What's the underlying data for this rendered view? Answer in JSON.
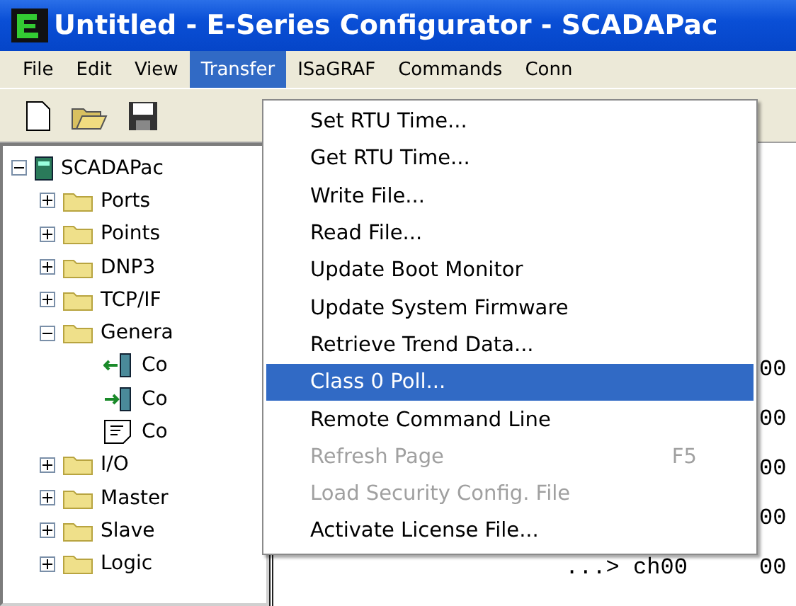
{
  "window": {
    "title": "Untitled - E-Series Configurator - SCADAPac"
  },
  "menu_bar": [
    {
      "label": "File",
      "selected": false
    },
    {
      "label": "Edit",
      "selected": false
    },
    {
      "label": "View",
      "selected": false
    },
    {
      "label": "Transfer",
      "selected": true
    },
    {
      "label": "ISaGRAF",
      "selected": false
    },
    {
      "label": "Commands",
      "selected": false
    },
    {
      "label": "Conn",
      "selected": false
    }
  ],
  "toolbar": [
    {
      "kind": "new"
    },
    {
      "kind": "open"
    },
    {
      "kind": "save"
    }
  ],
  "tree": [
    {
      "label": "SCADAPac",
      "kind": "device",
      "expanded": true,
      "children": [
        {
          "label": "Ports",
          "kind": "folder",
          "expanded": false
        },
        {
          "label": "Points",
          "kind": "folder",
          "expanded": false
        },
        {
          "label": "DNP3",
          "kind": "folder",
          "expanded": false
        },
        {
          "label": "TCP/IF",
          "kind": "folder",
          "expanded": false
        },
        {
          "label": "Genera",
          "kind": "folder",
          "expanded": true,
          "children": [
            {
              "label": "Co",
              "kind": "input"
            },
            {
              "label": "Co",
              "kind": "output"
            },
            {
              "label": "Co",
              "kind": "note"
            }
          ]
        },
        {
          "label": "I/O",
          "kind": "folder",
          "expanded": false
        },
        {
          "label": "Master",
          "kind": "folder",
          "expanded": false
        },
        {
          "label": "Slave",
          "kind": "folder",
          "expanded": false
        },
        {
          "label": "Logic",
          "kind": "folder",
          "expanded": false
        }
      ]
    }
  ],
  "log_lines": [
    {
      "value": "00"
    },
    {
      "value": "00"
    },
    {
      "value": "00"
    },
    {
      "value": "00"
    },
    {
      "prefix": "...> ch00",
      "value": "00"
    }
  ],
  "transfer_menu": [
    {
      "label": "Set RTU Time...",
      "disabled": false,
      "selected": false
    },
    {
      "label": "Get RTU Time...",
      "disabled": false,
      "selected": false
    },
    {
      "label": "Write File...",
      "disabled": false,
      "selected": false
    },
    {
      "label": "Read File...",
      "disabled": false,
      "selected": false
    },
    {
      "label": "Update Boot Monitor",
      "disabled": false,
      "selected": false
    },
    {
      "label": "Update System Firmware",
      "disabled": false,
      "selected": false
    },
    {
      "label": "Retrieve Trend Data...",
      "disabled": false,
      "selected": false
    },
    {
      "label": "Class 0 Poll...",
      "disabled": false,
      "selected": true
    },
    {
      "label": "Remote Command Line",
      "disabled": false,
      "selected": false
    },
    {
      "label": "Refresh Page",
      "shortcut": "F5",
      "disabled": true,
      "selected": false
    },
    {
      "label": "Load Security Config. File",
      "disabled": true,
      "selected": false
    },
    {
      "label": "Activate License File...",
      "disabled": false,
      "selected": false
    }
  ]
}
